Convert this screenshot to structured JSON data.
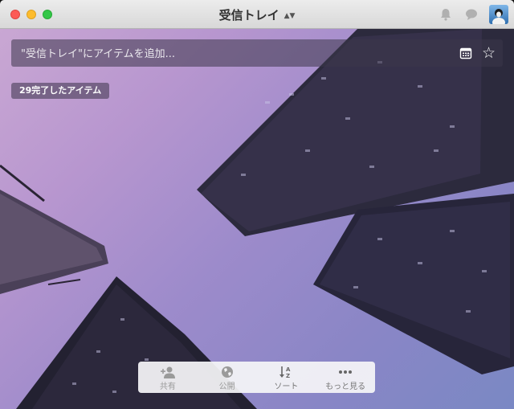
{
  "window": {
    "title": "受信トレイ",
    "title_dropdown_icon": "chevron-updown-icon"
  },
  "header": {
    "notifications_icon": "bell-icon",
    "comments_icon": "chat-bubble-icon",
    "avatar_icon": "user-avatar"
  },
  "add_item": {
    "placeholder": "\"受信トレイ\"にアイテムを追加...",
    "value": "",
    "calendar_icon": "calendar-icon",
    "star_icon": "star-icon"
  },
  "completed": {
    "label": "29完了したアイテム"
  },
  "toolbar": {
    "items": [
      {
        "label": "共有",
        "icon": "add-person-icon"
      },
      {
        "label": "公開",
        "icon": "globe-icon"
      },
      {
        "label": "ソート",
        "icon": "sort-az-icon"
      },
      {
        "label": "もっと見る",
        "icon": "more-dots-icon"
      }
    ]
  },
  "colors": {
    "close": "#fc5b57",
    "minimize": "#fdbc2e",
    "maximize": "#33c748"
  }
}
